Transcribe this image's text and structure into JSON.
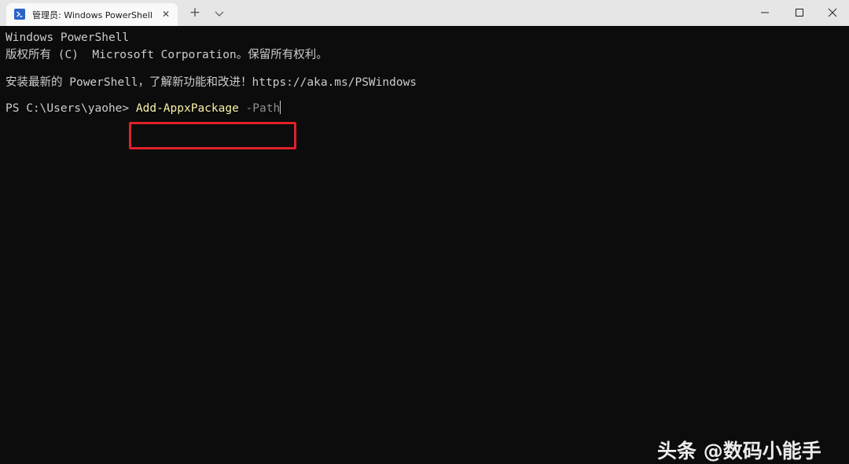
{
  "window": {
    "tab_title": "管理员: Windows PowerShell",
    "tab_icon": "powershell-icon",
    "new_tab_icon": "plus-icon",
    "dropdown_icon": "chevron-down-icon",
    "controls": [
      "minimize-icon",
      "maximize-icon",
      "close-icon"
    ]
  },
  "terminal": {
    "line1": "Windows PowerShell",
    "line2": "版权所有 (C)  Microsoft Corporation。保留所有权利。",
    "line3": "安装最新的 PowerShell，了解新功能和改进！https://aka.ms/PSWindows",
    "prompt": "PS C:\\Users\\yaohe> ",
    "command": "Add-AppxPackage",
    "parameter": " -Path"
  },
  "watermark": "头条 @数码小能手",
  "colors": {
    "terminal_bg": "#0c0c0c",
    "text": "#cccccc",
    "command": "#f9f1a5",
    "parameter": "#8f8f8f",
    "highlight": "#e0202a",
    "titlebar": "#e6e6e6"
  }
}
